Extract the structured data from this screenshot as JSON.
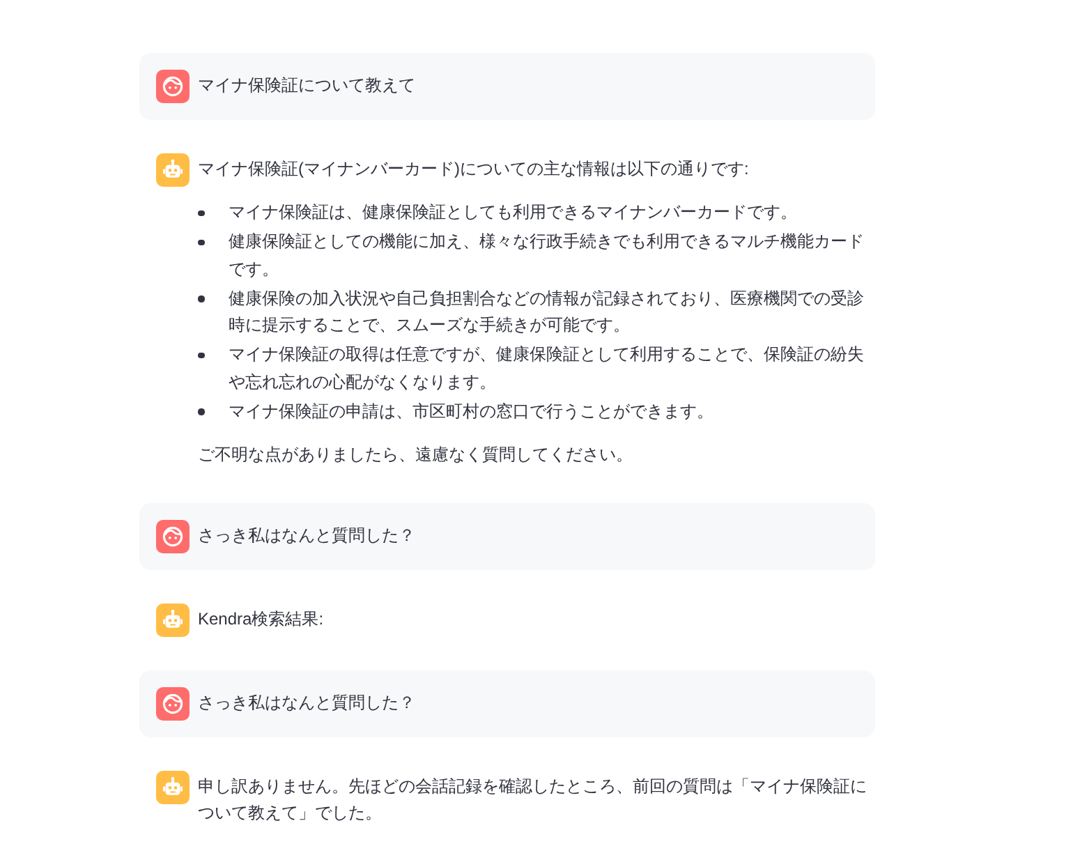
{
  "messages": [
    {
      "kind": "user",
      "blocks": [
        {
          "kind": "paragraph",
          "text": "マイナ保険証について教えて"
        }
      ]
    },
    {
      "kind": "assistant",
      "blocks": [
        {
          "kind": "paragraph",
          "text": "マイナ保険証(マイナンバーカード)についての主な情報は以下の通りです:"
        },
        {
          "kind": "list",
          "items": [
            "マイナ保険証は、健康保険証としても利用できるマイナンバーカードです。",
            "健康保険証としての機能に加え、様々な行政手続きでも利用できるマルチ機能カードです。",
            "健康保険の加入状況や自己負担割合などの情報が記録されており、医療機関での受診時に提示することで、スムーズな手続きが可能です。",
            "マイナ保険証の取得は任意ですが、健康保険証として利用することで、保険証の紛失や忘れ忘れの心配がなくなります。",
            "マイナ保険証の申請は、市区町村の窓口で行うことができます。"
          ]
        },
        {
          "kind": "paragraph",
          "text": "ご不明な点がありましたら、遠慮なく質問してください。"
        }
      ]
    },
    {
      "kind": "user",
      "blocks": [
        {
          "kind": "paragraph",
          "text": "さっき私はなんと質問した？"
        }
      ]
    },
    {
      "kind": "assistant",
      "blocks": [
        {
          "kind": "paragraph",
          "text": "Kendra検索結果:"
        }
      ]
    },
    {
      "kind": "user",
      "blocks": [
        {
          "kind": "paragraph",
          "text": "さっき私はなんと質問した？"
        }
      ]
    },
    {
      "kind": "assistant",
      "blocks": [
        {
          "kind": "paragraph",
          "text": "申し訳ありません。先ほどの会話記録を確認したところ、前回の質問は「マイナ保険証について教えて」でした。"
        }
      ]
    }
  ]
}
